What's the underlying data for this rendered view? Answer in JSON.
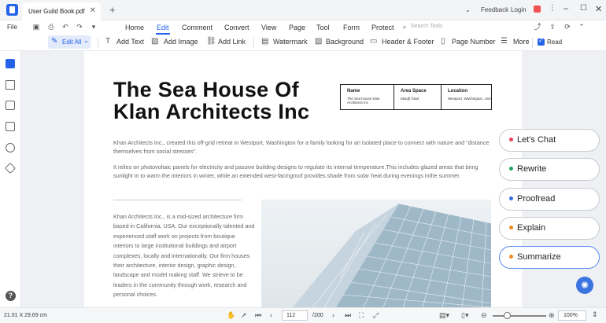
{
  "tab": {
    "title": "User Guild Book.pdf"
  },
  "titlebar": {
    "feedback": "Feedback",
    "login": "Login"
  },
  "menu": {
    "file": "File",
    "items": [
      "Home",
      "Edit",
      "Comment",
      "Convert",
      "View",
      "Page",
      "Tool",
      "Form",
      "Protect"
    ],
    "active": "Edit",
    "search_placeholder": "Search Tools"
  },
  "toolbar": {
    "edit_all": "Edit All",
    "add_text": "Add Text",
    "add_image": "Add Image",
    "add_link": "Add Link",
    "watermark": "Watermark",
    "background": "Background",
    "header_footer": "Header & Footer",
    "page_number": "Page Number",
    "more": "More",
    "read": "Read"
  },
  "document": {
    "title_line1": "The Sea House Of",
    "title_line2": "Klan Architects Inc",
    "info_table": {
      "name_header": "Name",
      "name_value": "The Sea House Klan Architects Inc",
      "area_header": "Area Space",
      "area_value": "55sqft Total",
      "location_header": "Location",
      "location_value": "Westport, Washington, USA"
    },
    "para1": "Khan Architects Inc., created this off-grid retreat in Westport, Washington for a family looking for an isolated place to connect with nature and \"distance themselves from social stresses\".",
    "para2": "It relies on photovoltaic panels for electricity and passive building designs to regulate its internal temperature.This includes glazed areas that bring sunlight in to warm the interiors in winter, while an extended west-facingroof provides shade from solar heat during evenings inthe summer.",
    "col_text": "Khan Architects Inc., is a mid-sized architecture firm based in California, USA. Our exceptionally talented and experienced staff work on projects from boutique interiors to large institutional buildings and airport complexes, locally and internationally. Our firm houses their architecture, interior design, graphic design, landscape and model making staff. We strieve to be leaders in the community through work, research and personal choices."
  },
  "ai_panel": [
    {
      "label": "Let's Chat",
      "dot": "#e8435a"
    },
    {
      "label": "Rewrite",
      "dot": "#22a45d"
    },
    {
      "label": "Proofread",
      "dot": "#2f6fdf"
    },
    {
      "label": "Explain",
      "dot": "#f08a24"
    },
    {
      "label": "Summarize",
      "dot": "#f08a24"
    }
  ],
  "statusbar": {
    "dimensions": "21.01 X 29.69 cm",
    "page_current": "112",
    "page_total": "/200",
    "zoom": "100%",
    "zoom_fraction": 0.2
  }
}
